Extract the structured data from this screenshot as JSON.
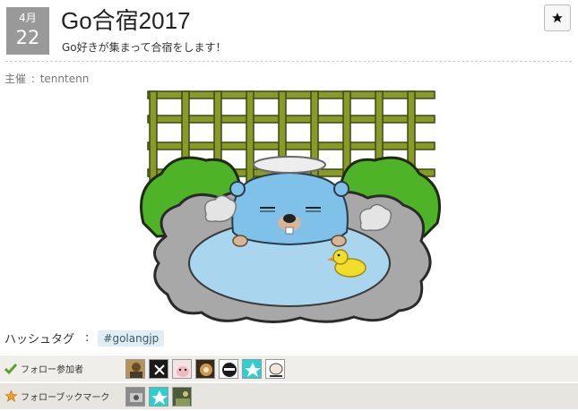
{
  "event": {
    "month": "4月",
    "day": "22",
    "title": "Go合宿2017",
    "catch": "Go好きが集まって合宿をします！",
    "organizer_label": "主催",
    "organizer_sep": ":",
    "organizer_name": "tenntenn"
  },
  "hashtag": {
    "label": "ハッシュタグ",
    "sep": ":",
    "tag": "#golangjp"
  },
  "follow_participants": {
    "label": "フォロー参加者",
    "icon": "check-icon",
    "avatars": [
      "avatar-1",
      "avatar-2",
      "avatar-3",
      "avatar-4",
      "avatar-5",
      "avatar-6",
      "avatar-7"
    ]
  },
  "follow_bookmarks": {
    "label": "フォローブックマーク",
    "icon": "star-icon",
    "avatars": [
      "avatar-1",
      "avatar-2",
      "avatar-3"
    ]
  },
  "icons": {
    "bookmark_button": "star-icon"
  },
  "colors": {
    "date_badge": "#999999",
    "hashtag_bg": "#dfeef4",
    "row_bg": "#efeeea",
    "check": "#5aa02c",
    "star": "#f0a020"
  }
}
